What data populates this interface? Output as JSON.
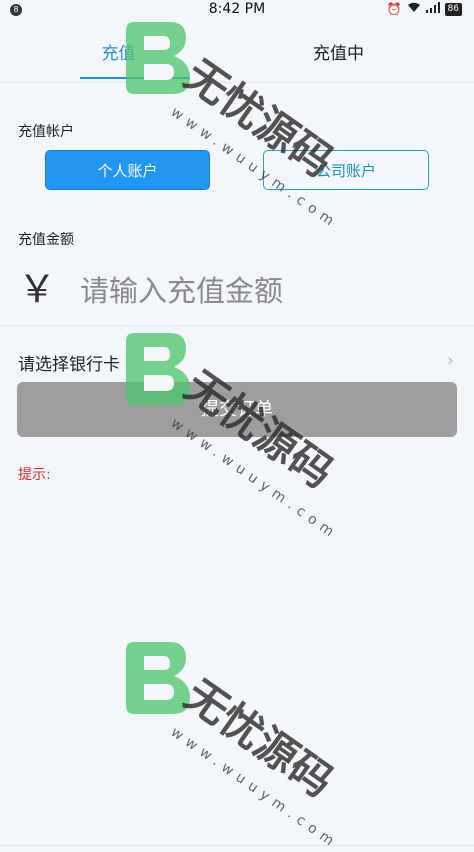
{
  "status_bar": {
    "notification_count": "8",
    "time": "8:42 PM",
    "battery": "86",
    "icons": [
      "alarm-icon",
      "wifi-icon",
      "signal-icon",
      "battery-icon"
    ]
  },
  "tabs": [
    {
      "label": "充值",
      "active": true
    },
    {
      "label": "充值中",
      "active": false
    }
  ],
  "account_section": {
    "label": "充值帐户",
    "options": [
      {
        "label": "个人账户",
        "selected": true
      },
      {
        "label": "公司账户",
        "selected": false
      }
    ]
  },
  "amount_section": {
    "label": "充值金额",
    "currency_symbol": "￥",
    "placeholder": "请输入充值金额",
    "value": ""
  },
  "bank_card": {
    "label": "请选择银行卡"
  },
  "submit": {
    "label": "提交订单"
  },
  "hint": {
    "label": "提示:"
  },
  "watermark": {
    "text": "无忧源码",
    "url": "www.wuuym.com"
  },
  "colors": {
    "accent": "#2196f3",
    "tab_active": "#2b8fd8",
    "submit_bg": "#9e9e9e",
    "hint": "#d32f2f",
    "watermark_green": "#4cc46b"
  }
}
